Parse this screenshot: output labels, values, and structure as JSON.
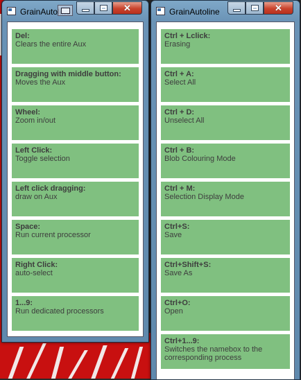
{
  "windows": [
    {
      "title": "GrainAutoline",
      "cards": [
        {
          "key": "Del:",
          "desc": "Clears the entire Aux"
        },
        {
          "key": "Dragging with middle button:",
          "desc": "Moves the Aux"
        },
        {
          "key": "Wheel:",
          "desc": "Zoom in/out"
        },
        {
          "key": "Left Click:",
          "desc": "Toggle selection"
        },
        {
          "key": "Left click dragging:",
          "desc": "draw on Aux"
        },
        {
          "key": "Space:",
          "desc": "Run current processor"
        },
        {
          "key": "Right Click:",
          "desc": "auto-select"
        },
        {
          "key": "1...9:",
          "desc": "Run dedicated processors"
        }
      ]
    },
    {
      "title": "GrainAutoline",
      "cards": [
        {
          "key": "Ctrl + Lclick:",
          "desc": "Erasing"
        },
        {
          "key": "Ctrl + A:",
          "desc": "Select All"
        },
        {
          "key": "Ctrl + D:",
          "desc": "Unselect All"
        },
        {
          "key": "Ctrl + B:",
          "desc": "Blob Colouring Mode"
        },
        {
          "key": "Ctrl + M:",
          "desc": "Selection Display Mode"
        },
        {
          "key": "Ctrl+S:",
          "desc": "Save"
        },
        {
          "key": "Ctrl+Shift+S:",
          "desc": "Save As"
        },
        {
          "key": "Ctrl+O:",
          "desc": "Open"
        },
        {
          "key": "Ctrl+1...9:",
          "desc": "Switches the namebox to the corresponding process"
        }
      ]
    }
  ],
  "colors": {
    "card_bg": "#80c080",
    "card_text": "#3d3d3d",
    "close_button": "#c9432d"
  },
  "icons": [
    "app-icon",
    "minimize-icon",
    "maximize-icon",
    "close-icon"
  ]
}
